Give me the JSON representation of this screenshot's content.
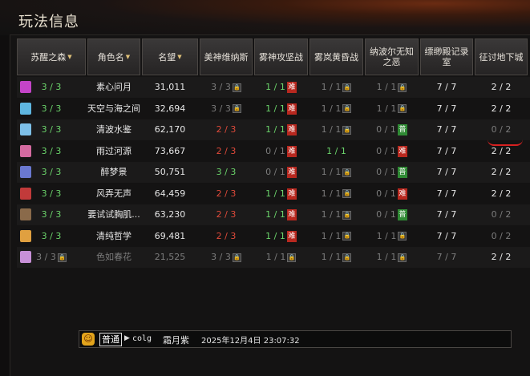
{
  "window": {
    "title": "玩法信息"
  },
  "columns": [
    {
      "label": "苏醒之森",
      "sortable": true
    },
    {
      "label": "角色名",
      "sortable": true
    },
    {
      "label": "名望",
      "sortable": true
    },
    {
      "label": "美神维纳斯",
      "sortable": false
    },
    {
      "label": "雾神攻坚战",
      "sortable": false
    },
    {
      "label": "雾岚黄昏战",
      "sortable": false
    },
    {
      "label": "纳波尔无知之恶",
      "sortable": false
    },
    {
      "label": "缥缈殿记录室",
      "sortable": false
    },
    {
      "label": "征讨地下城",
      "sortable": false
    }
  ],
  "rows": [
    {
      "avatar_color": "#c444c8",
      "awaken": "3 / 3",
      "name": "素心问月",
      "fame": "31,011",
      "venus": "3 / 3",
      "venus_lock": true,
      "fog": "1 / 1",
      "fog_badge": "难",
      "dusk": "1 / 1",
      "dusk_lock": true,
      "nabor": "1 / 1",
      "nabor_lock": true,
      "record": "7 / 7",
      "dungeon": "2 / 2"
    },
    {
      "avatar_color": "#5fb6e0",
      "awaken": "3 / 3",
      "name": "天空与海之间",
      "fame": "32,694",
      "venus": "3 / 3",
      "venus_lock": true,
      "fog": "1 / 1",
      "fog_badge": "难",
      "dusk": "1 / 1",
      "dusk_lock": true,
      "nabor": "1 / 1",
      "nabor_lock": true,
      "record": "7 / 7",
      "dungeon": "2 / 2"
    },
    {
      "avatar_color": "#7ec0e8",
      "awaken": "3 / 3",
      "name": "清波水鉴",
      "fame": "62,170",
      "venus": "2 / 3",
      "venus_lock": false,
      "fog": "1 / 1",
      "fog_badge": "难",
      "dusk": "1 / 1",
      "dusk_lock": true,
      "nabor": "0 / 1",
      "nabor_badge": "普",
      "record": "7 / 7",
      "dungeon": "0 / 2"
    },
    {
      "avatar_color": "#d46aa0",
      "awaken": "3 / 3",
      "name": "雨过河源",
      "fame": "73,667",
      "venus": "2 / 3",
      "venus_lock": false,
      "fog": "0 / 1",
      "fog_badge": "难",
      "dusk": "1 / 1",
      "dusk_lock": false,
      "nabor": "0 / 1",
      "nabor_badge": "难",
      "record": "7 / 7",
      "dungeon": "2 / 2"
    },
    {
      "avatar_color": "#6a78d0",
      "awaken": "3 / 3",
      "name": "醉梦景",
      "fame": "50,751",
      "venus": "3 / 3",
      "venus_lock": false,
      "fog": "0 / 1",
      "fog_badge": "难",
      "dusk": "1 / 1",
      "dusk_lock": true,
      "nabor": "0 / 1",
      "nabor_badge": "普",
      "record": "7 / 7",
      "dungeon": "2 / 2"
    },
    {
      "avatar_color": "#c23a3a",
      "awaken": "3 / 3",
      "name": "风弄无声",
      "fame": "64,459",
      "venus": "2 / 3",
      "venus_lock": false,
      "fog": "1 / 1",
      "fog_badge": "难",
      "dusk": "1 / 1",
      "dusk_lock": true,
      "nabor": "0 / 1",
      "nabor_badge": "难",
      "record": "7 / 7",
      "dungeon": "2 / 2"
    },
    {
      "avatar_color": "#8a6a4a",
      "awaken": "3 / 3",
      "name": "要试试胸肌...",
      "fame": "63,230",
      "venus": "2 / 3",
      "venus_lock": false,
      "fog": "1 / 1",
      "fog_badge": "难",
      "dusk": "1 / 1",
      "dusk_lock": true,
      "nabor": "0 / 1",
      "nabor_badge": "普",
      "record": "7 / 7",
      "dungeon": "0 / 2"
    },
    {
      "avatar_color": "#e0a040",
      "awaken": "3 / 3",
      "name": "清纯哲学",
      "fame": "69,481",
      "venus": "2 / 3",
      "venus_lock": false,
      "fog": "1 / 1",
      "fog_badge": "难",
      "dusk": "1 / 1",
      "dusk_lock": true,
      "nabor": "1 / 1",
      "nabor_lock": true,
      "record": "7 / 7",
      "dungeon": "0 / 2"
    },
    {
      "avatar_color": "#c890d8",
      "awaken": "3 / 3",
      "awaken_lock": true,
      "name": "色如春花",
      "fame": "21,525",
      "venus": "3 / 3",
      "venus_lock": true,
      "fog": "1 / 1",
      "fog_lock": true,
      "dusk": "1 / 1",
      "dusk_lock": true,
      "nabor": "1 / 1",
      "nabor_lock": true,
      "record": "7 / 7",
      "dungeon": "2 / 2"
    }
  ],
  "chat": {
    "channel": "普通",
    "name": "colg",
    "role": "霜月紫",
    "time": "2025年12月4日 23:07:32"
  },
  "colors": {
    "green": "#6bd46b",
    "red": "#e04a3a",
    "hard_badge": "#b8281f",
    "normal_badge": "#2f8a34"
  }
}
